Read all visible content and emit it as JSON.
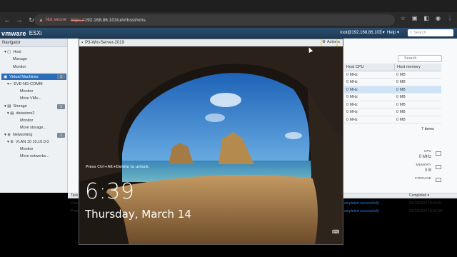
{
  "browser": {
    "security_label": "Not secure",
    "url_scheme": "https://",
    "url_rest": "192.168.86.103/ui/#/host/vms"
  },
  "esxi": {
    "brand": "vmware",
    "product": "ESXi",
    "user": "root@192.168.86.103 ▾",
    "help": "Help ▾",
    "search_placeholder": "Search"
  },
  "navigator": {
    "title": "Navigator",
    "host": "Host",
    "host_manage": "Manage",
    "host_monitor": "Monitor",
    "vms": "Virtual Machines",
    "vms_count": "1",
    "vm_name": "EVE-NG-COMM",
    "vm_monitor": "Monitor",
    "vm_more": "More VMs...",
    "storage": "Storage",
    "storage_count": "1",
    "datastore": "datastore2",
    "ds_monitor": "Monitor",
    "ds_more": "More storage...",
    "networking": "Networking",
    "net_count": "1",
    "vlan": "VLAN 10 10.10.0.0",
    "net_monitor": "Monitor",
    "net_more": "More networks..."
  },
  "vm_list": {
    "search_placeholder": "Search",
    "col_cpu": "Host CPU",
    "col_mem": "Host memory",
    "rows": [
      {
        "cpu": "0 MHz",
        "mem": "0 MB"
      },
      {
        "cpu": "0 MHz",
        "mem": "0 MB"
      },
      {
        "cpu": "0 MHz",
        "mem": "0 MB"
      },
      {
        "cpu": "0 MHz",
        "mem": "0 MB"
      },
      {
        "cpu": "0 MHz",
        "mem": "0 MB"
      },
      {
        "cpu": "0 MHz",
        "mem": "0 MB"
      },
      {
        "cpu": "0 MHz",
        "mem": "0 MB"
      }
    ],
    "items_count": "7 items"
  },
  "summary": {
    "cpu_label": "CPU",
    "cpu_value": "0 MHz",
    "mem_label": "MEMORY",
    "mem_value": "0 B",
    "storage_label": "STORAGE"
  },
  "tasks": {
    "tab_label": "Task",
    "completed_label": "Completed ▾",
    "row1_left": "Crea",
    "row1_status": "ompleted successfully",
    "row1_time": "03/14/2024 19:53:01",
    "row2_left": "Powe",
    "row2_status": "ompleted successfully",
    "row2_time": "03/14/2024 19:52:59"
  },
  "console": {
    "title": "P3-Win-Server-2019",
    "actions": "Actions",
    "hint": "Press Ctrl+Alt+Delete to unlock.",
    "time": "6:39",
    "date": "Thursday, March 14"
  },
  "colors": {
    "selection_blue": "#2a6ebb",
    "header_blue": "#1d3a57",
    "highlight_circle": "#f1d21b"
  }
}
